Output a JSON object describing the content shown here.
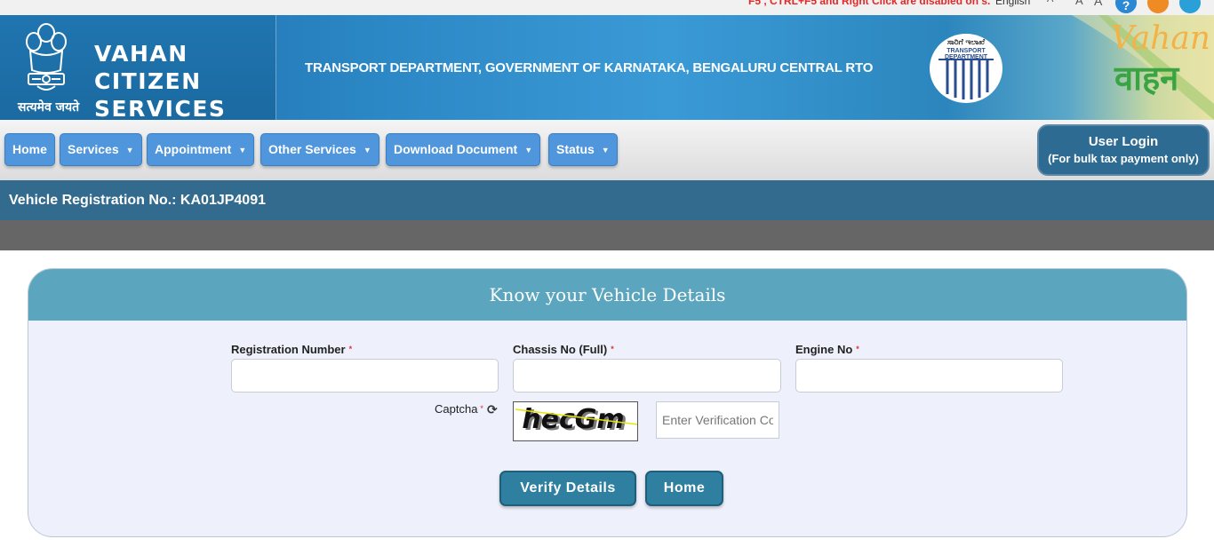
{
  "topbar": {
    "notice": "F5 , CTRL+F5 and Right Click are disabled on s.",
    "language": "English",
    "font_small": "A",
    "font_normal": "A",
    "font_large": "A",
    "icons": [
      "help-icon",
      "rss-icon",
      "phone-icon"
    ]
  },
  "header": {
    "emblem_motto": "सत्यमेव जयते",
    "brand_line1": "VAHAN CITIZEN",
    "brand_line2": "SERVICES",
    "department": "TRANSPORT DEPARTMENT, GOVERNMENT OF KARNATAKA, BENGALURU CENTRAL RTO",
    "dept_logo_kannada": "ಸಾರಿಗೆ ಇಲಾಖೆ",
    "dept_logo_english": "TRANSPORT DEPARTMENT",
    "vahan_logo_en": "Vahan",
    "vahan_logo_hi": "वाहन"
  },
  "nav": {
    "items": [
      {
        "label": "Home"
      },
      {
        "label": "Services"
      },
      {
        "label": "Appointment"
      },
      {
        "label": "Other Services"
      },
      {
        "label": "Download Document"
      },
      {
        "label": "Status"
      }
    ],
    "caret": "▼",
    "user_login": "User Login",
    "user_login_sub": "(For bulk tax payment only)"
  },
  "registration_bar": {
    "text": "Vehicle Registration No.: KA01JP4091"
  },
  "form": {
    "title": "Know your Vehicle Details",
    "registration_label": "Registration Number",
    "chassis_label": "Chassis No (Full)",
    "engine_label": "Engine No",
    "required_mark": "*",
    "registration_value": "",
    "chassis_value": "",
    "engine_value": "",
    "captcha_label": "Captcha",
    "captcha_text": "hecGm",
    "verification_placeholder": "Enter Verification Code",
    "verify_button": "Verify Details",
    "home_button": "Home"
  },
  "colors": {
    "nav_button": "#4f96dc",
    "reg_bar": "#336b8f",
    "card_header": "#5ba6be",
    "action_button": "#2e7fa0"
  }
}
